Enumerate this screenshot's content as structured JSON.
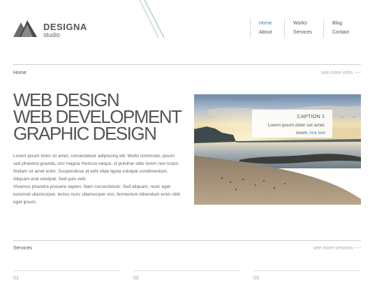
{
  "brand": {
    "name": "DESIGNA",
    "tagline": "studio"
  },
  "nav": {
    "home": "Home",
    "about": "About",
    "works": "Works",
    "services": "Services",
    "blog": "Blog",
    "contact": "Contact",
    "active_color": "#3a87b8"
  },
  "breadcrumb": {
    "label": "Home",
    "more": "see more infos ----"
  },
  "headline": [
    "WEB DESIGN",
    "WEB DEVELOPMENT",
    "GRAPHIC DESIGN"
  ],
  "paragraphs": [
    "Lorem ipsum dolor sit amet, consectetuer adipiscing elit. Morbi commodo, ipsum sed pharetra gravida, orci magna rhoncus neque, id pulvinar odio lorem non turpis. Nullam sit amet enim. Suspendisse id velit vitae ligula volutpat condimentum. Aliquam erat volutpat. Sed quis velit.",
    "Vivamus pharetra posuere sapien. Nam consectetuer. Sed aliquam, nunc eget euismod ullamcorper, lectus nunc ullamcorper orci, fermentum bibendum enim nibh eget ipsum."
  ],
  "slider": {
    "caption_title": "CAPTION 1",
    "caption_text": "Lorem ipsum dolor set amet, lorem,",
    "caption_link": "link text",
    "prev": "←",
    "next": "→",
    "image": "beach-sunset"
  },
  "services": {
    "label": "Services",
    "more": "see more services ----",
    "items": [
      "01",
      "02",
      "03"
    ]
  }
}
